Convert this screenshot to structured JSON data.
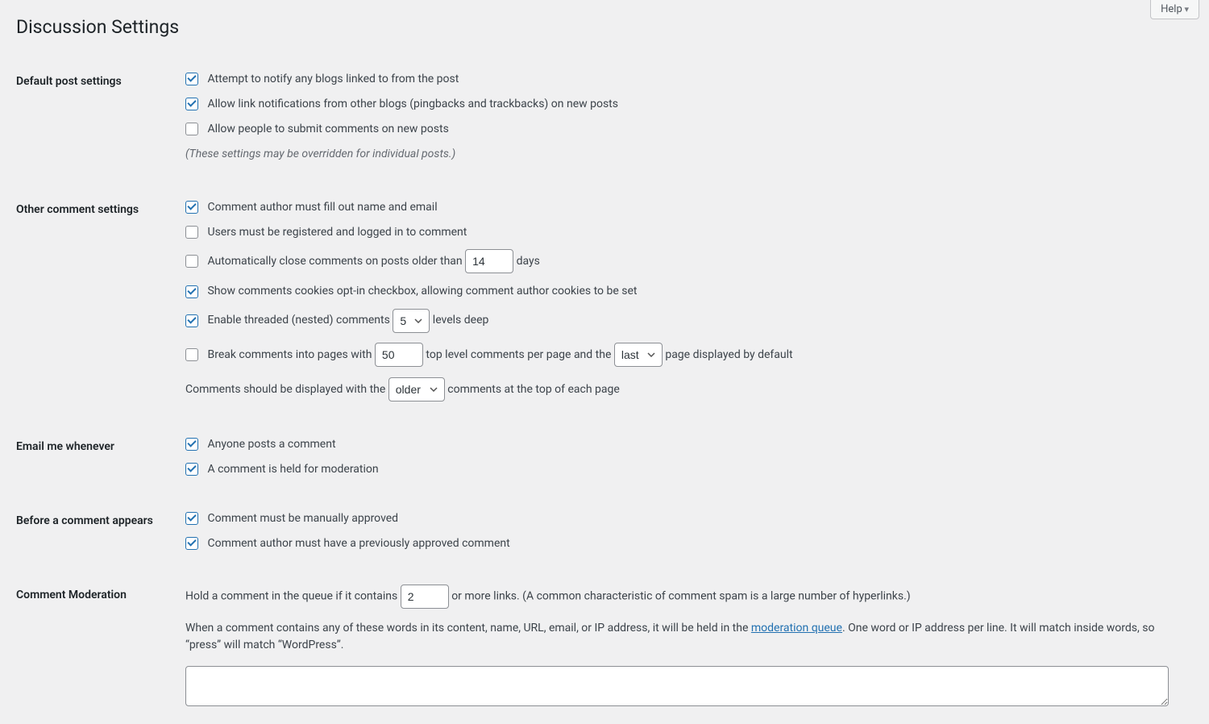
{
  "help_label": "Help",
  "page_title": "Discussion Settings",
  "sections": {
    "default_post": {
      "heading": "Default post settings",
      "notify_blogs": "Attempt to notify any blogs linked to from the post",
      "allow_pingbacks": "Allow link notifications from other blogs (pingbacks and trackbacks) on new posts",
      "allow_comments": "Allow people to submit comments on new posts",
      "override_note": "(These settings may be overridden for individual posts.)"
    },
    "other_comment": {
      "heading": "Other comment settings",
      "require_name_email": "Comment author must fill out name and email",
      "require_registration": "Users must be registered and logged in to comment",
      "auto_close_pre": "Automatically close comments on posts older than ",
      "auto_close_days_value": "14",
      "auto_close_post": " days",
      "cookies_optin": "Show comments cookies opt-in checkbox, allowing comment author cookies to be set",
      "threaded_pre": "Enable threaded (nested) comments ",
      "threaded_value": "5",
      "threaded_post": " levels deep",
      "break_pages_pre": "Break comments into pages with ",
      "break_pages_value": "50",
      "break_pages_mid": " top level comments per page and the ",
      "break_pages_select": "last",
      "break_pages_post": " page displayed by default",
      "order_pre": "Comments should be displayed with the ",
      "order_value": "older",
      "order_post": " comments at the top of each page"
    },
    "email_me": {
      "heading": "Email me whenever",
      "anyone_posts": "Anyone posts a comment",
      "held_moderation": "A comment is held for moderation"
    },
    "before_appears": {
      "heading": "Before a comment appears",
      "manual_approve": "Comment must be manually approved",
      "prev_approved": "Comment author must have a previously approved comment"
    },
    "moderation": {
      "heading": "Comment Moderation",
      "hold_links_pre": "Hold a comment in the queue if it contains ",
      "hold_links_value": "2",
      "hold_links_post": " or more links. (A common characteristic of comment spam is a large number of hyperlinks.)",
      "desc_pre": "When a comment contains any of these words in its content, name, URL, email, or IP address, it will be held in the ",
      "desc_link": "moderation queue",
      "desc_post": ". One word or IP address per line. It will match inside words, so “press” will match “WordPress”."
    }
  }
}
